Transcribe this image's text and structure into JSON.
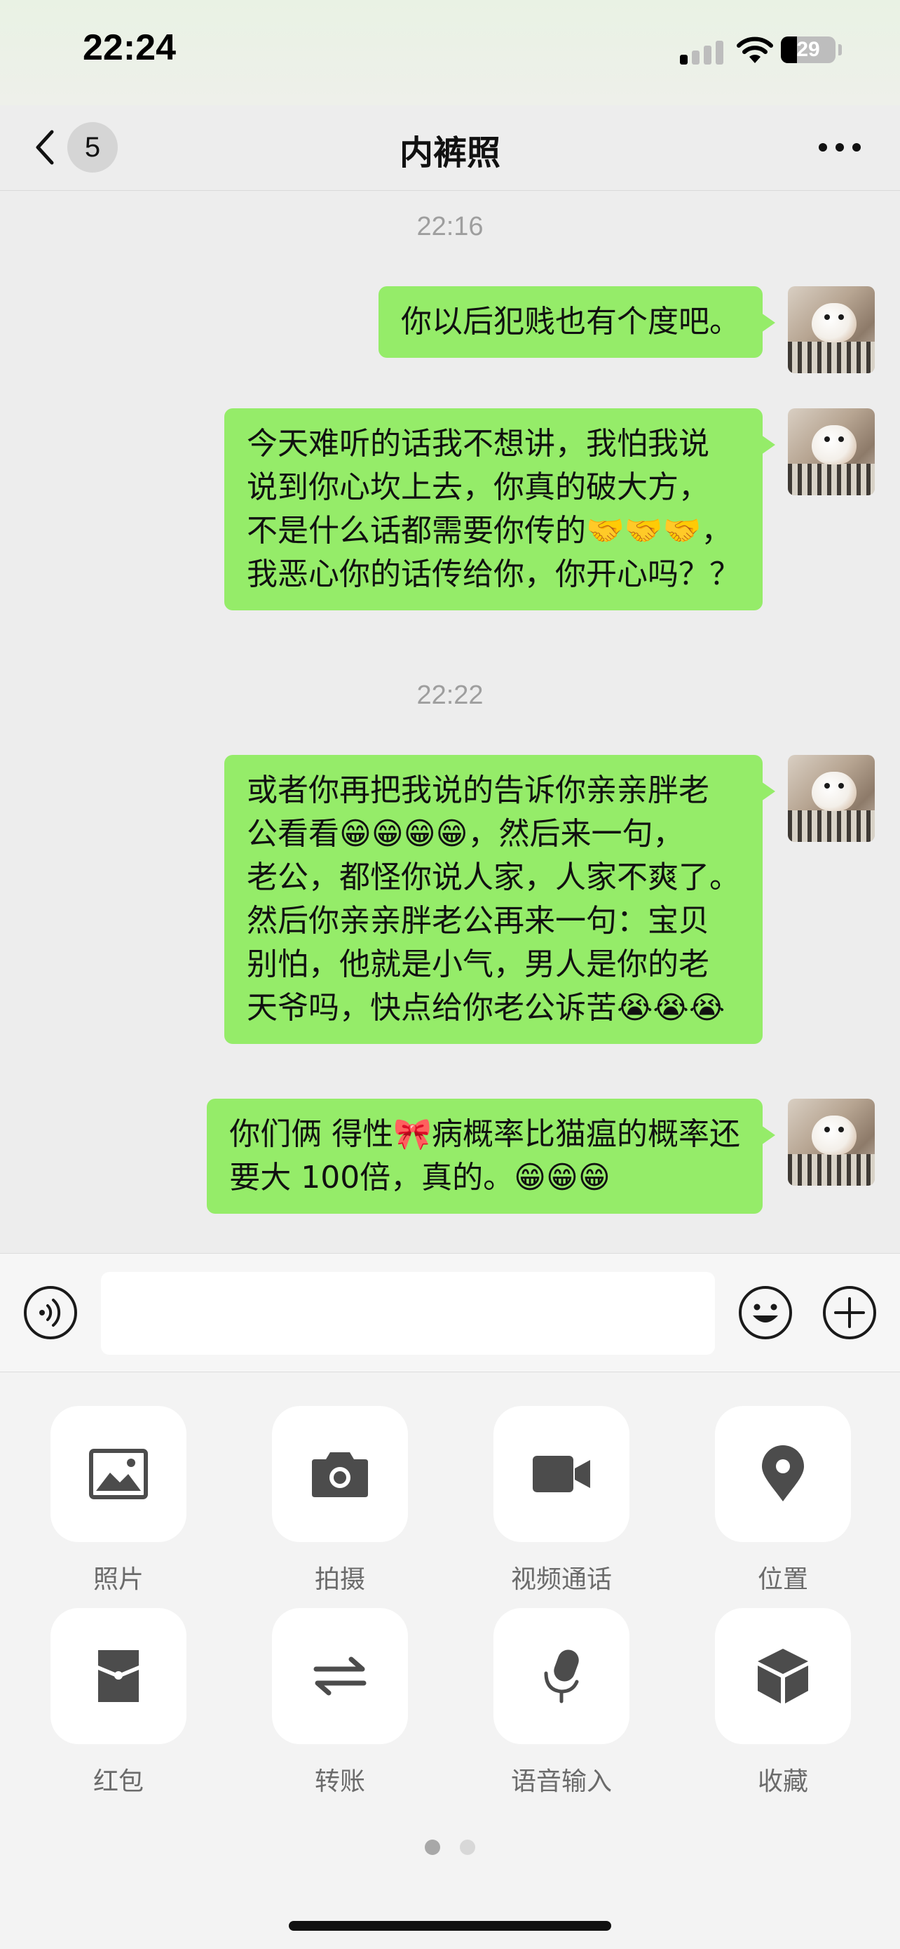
{
  "status_bar": {
    "time": "22:24",
    "battery": "29",
    "battery_level": 0.29,
    "signal_bars_active": 1,
    "signal_bars_total": 4
  },
  "nav": {
    "back_icon": "chevron-left-icon",
    "unread_count": "5",
    "title": "内裤照",
    "more_icon": "more-dots-icon"
  },
  "messages": [
    {
      "type": "timestamp",
      "text": "22:16"
    },
    {
      "type": "sent",
      "lines": [
        "你以后犯贱也有个度吧。"
      ]
    },
    {
      "type": "sent",
      "lines": [
        "今天难听的话我不想讲，我怕我说",
        "说到你心坎上去，你真的破大方，",
        "不是什么话都需要你传的🤝🤝🤝，",
        "我恶心你的话传给你，你开心吗？？"
      ]
    },
    {
      "type": "timestamp",
      "text": "22:22"
    },
    {
      "type": "sent",
      "lines": [
        "或者你再把我说的告诉你亲亲胖老",
        "公看看😁😁😁😁，然后来一句，",
        "老公，都怪你说人家，人家不爽了。",
        "然后你亲亲胖老公再来一句：宝贝",
        "别怕，他就是小气，男人是你的老",
        "天爷吗，快点给你老公诉苦😭😭😭"
      ]
    },
    {
      "type": "sent",
      "lines": [
        "你们俩 得性🎀病概率比猫瘟的概率还",
        "要大 100倍，真的。😁😁😁"
      ]
    }
  ],
  "input": {
    "voice_icon": "voice-icon",
    "value": "",
    "emoji_icon": "emoji-icon",
    "plus_icon": "plus-icon"
  },
  "tools": [
    {
      "icon": "photo-icon",
      "label": "照片"
    },
    {
      "icon": "camera-icon",
      "label": "拍摄"
    },
    {
      "icon": "video-call-icon",
      "label": "视频通话"
    },
    {
      "icon": "location-icon",
      "label": "位置"
    },
    {
      "icon": "red-packet-icon",
      "label": "红包"
    },
    {
      "icon": "transfer-icon",
      "label": "转账"
    },
    {
      "icon": "microphone-icon",
      "label": "语音输入"
    },
    {
      "icon": "favorites-icon",
      "label": "收藏"
    }
  ],
  "pagination": {
    "pages": 2,
    "active": 1
  },
  "colors": {
    "bubble": "#95ec69",
    "chat_bg": "#ededed",
    "icon": "#4c4c4c",
    "timestamp": "#9e9e9e"
  }
}
